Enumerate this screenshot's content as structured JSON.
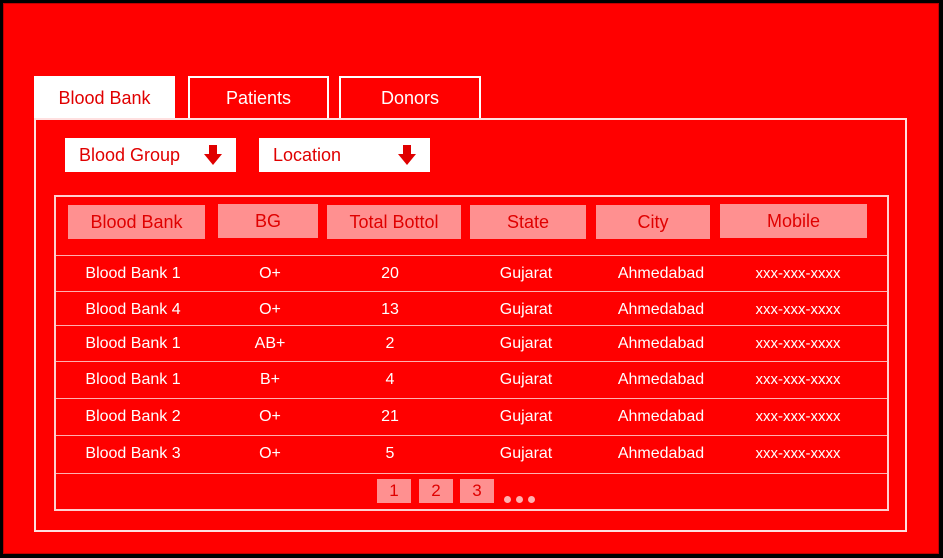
{
  "tabs": [
    {
      "label": "Blood Bank",
      "active": true
    },
    {
      "label": "Patients",
      "active": false
    },
    {
      "label": "Donors",
      "active": false
    }
  ],
  "filters": {
    "blood_group": {
      "label": "Blood Group",
      "icon": "arrow-down-icon"
    },
    "location": {
      "label": "Location",
      "icon": "arrow-down-icon"
    }
  },
  "table": {
    "columns": [
      "Blood Bank",
      "BG",
      "Total Bottol",
      "State",
      "City",
      "Mobile"
    ],
    "rows": [
      [
        "Blood Bank 1",
        "O+",
        "20",
        "Gujarat",
        "Ahmedabad",
        "xxx-xxx-xxxx"
      ],
      [
        "Blood Bank 4",
        "O+",
        "13",
        "Gujarat",
        "Ahmedabad",
        "xxx-xxx-xxxx"
      ],
      [
        "Blood Bank 1",
        "AB+",
        "2",
        "Gujarat",
        "Ahmedabad",
        "xxx-xxx-xxxx"
      ],
      [
        "Blood Bank 1",
        "B+",
        "4",
        "Gujarat",
        "Ahmedabad",
        "xxx-xxx-xxxx"
      ],
      [
        "Blood Bank 2",
        "O+",
        "21",
        "Gujarat",
        "Ahmedabad",
        "xxx-xxx-xxxx"
      ],
      [
        "Blood Bank 3",
        "O+",
        "5",
        "Gujarat",
        "Ahmedabad",
        "xxx-xxx-xxxx"
      ]
    ]
  },
  "pagination": {
    "pages": [
      "1",
      "2",
      "3"
    ],
    "more_icon": "ellipsis-icon"
  },
  "colors": {
    "background": "#ff0000",
    "header_cell": "#ff9090",
    "text_accent": "#e00000"
  }
}
